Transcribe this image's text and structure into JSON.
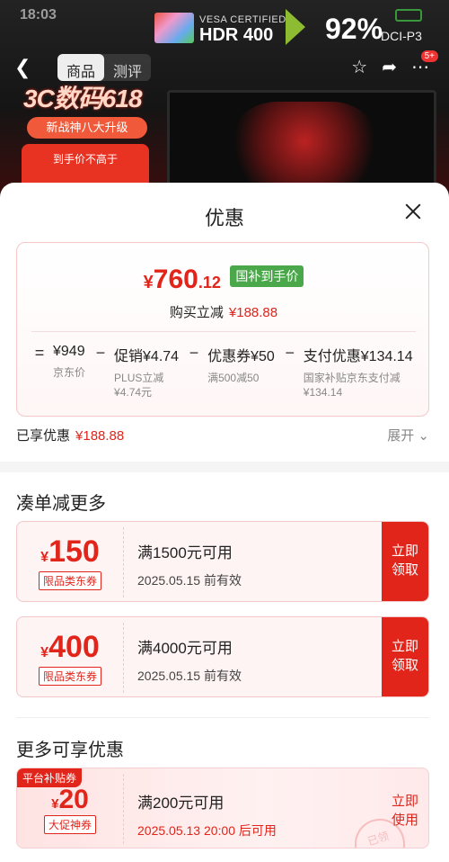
{
  "background": {
    "status_time": "18:03",
    "hdr_cert": "VESA CERTIFIED",
    "hdr_level": "HDR 400",
    "color_pct": "92%",
    "color_space": "DCI-P3",
    "tabs": [
      "商品",
      "测评"
    ],
    "cart_badge": "5+",
    "promo": {
      "big": "3C数码618",
      "pill": "新战神八大升级",
      "card": "到手价不高于"
    }
  },
  "sheet": {
    "title": "优惠",
    "final_price": {
      "yen": "¥",
      "int": "760",
      "dec": ".12",
      "tag": "国补到手价"
    },
    "save_label": "购买立减",
    "save_amount": "¥188.88",
    "calc": {
      "eq": "=",
      "terms": [
        {
          "main": "¥949",
          "sub": "京东价"
        },
        {
          "main": "促销¥4.74",
          "sub": "PLUS立减\n¥4.74元"
        },
        {
          "main": "优惠券¥50",
          "sub": "满500减50"
        },
        {
          "main": "支付优惠¥134.14",
          "sub": "国家补贴京东支付减\n¥134.14"
        }
      ],
      "minus": "−"
    },
    "enjoyed_label": "已享优惠",
    "enjoyed_amount": "¥188.88",
    "expand_label": "展开 ⌄",
    "section1_title": "凑单减更多",
    "coupons": [
      {
        "yen": "¥",
        "amount": "150",
        "label": "限品类东券",
        "condition": "满1500元可用",
        "date": "2025.05.15 前有效",
        "button": "立即\n领取"
      },
      {
        "yen": "¥",
        "amount": "400",
        "label": "限品类东券",
        "condition": "满4000元可用",
        "date": "2025.05.15 前有效",
        "button": "立即\n领取"
      }
    ],
    "section2_title": "更多可享优惠",
    "coupon3": {
      "corner": "平台补贴券",
      "yen": "¥",
      "amount": "20",
      "label": "大促神券",
      "condition": "满200元可用",
      "date": "2025.05.13 20:00 后可用",
      "button": "立即\n使用",
      "stamp": "已领"
    }
  },
  "colors": {
    "accent_red": "#e1251b",
    "tag_green": "#4aa84a",
    "bg_dark": "#1a1a1a"
  }
}
